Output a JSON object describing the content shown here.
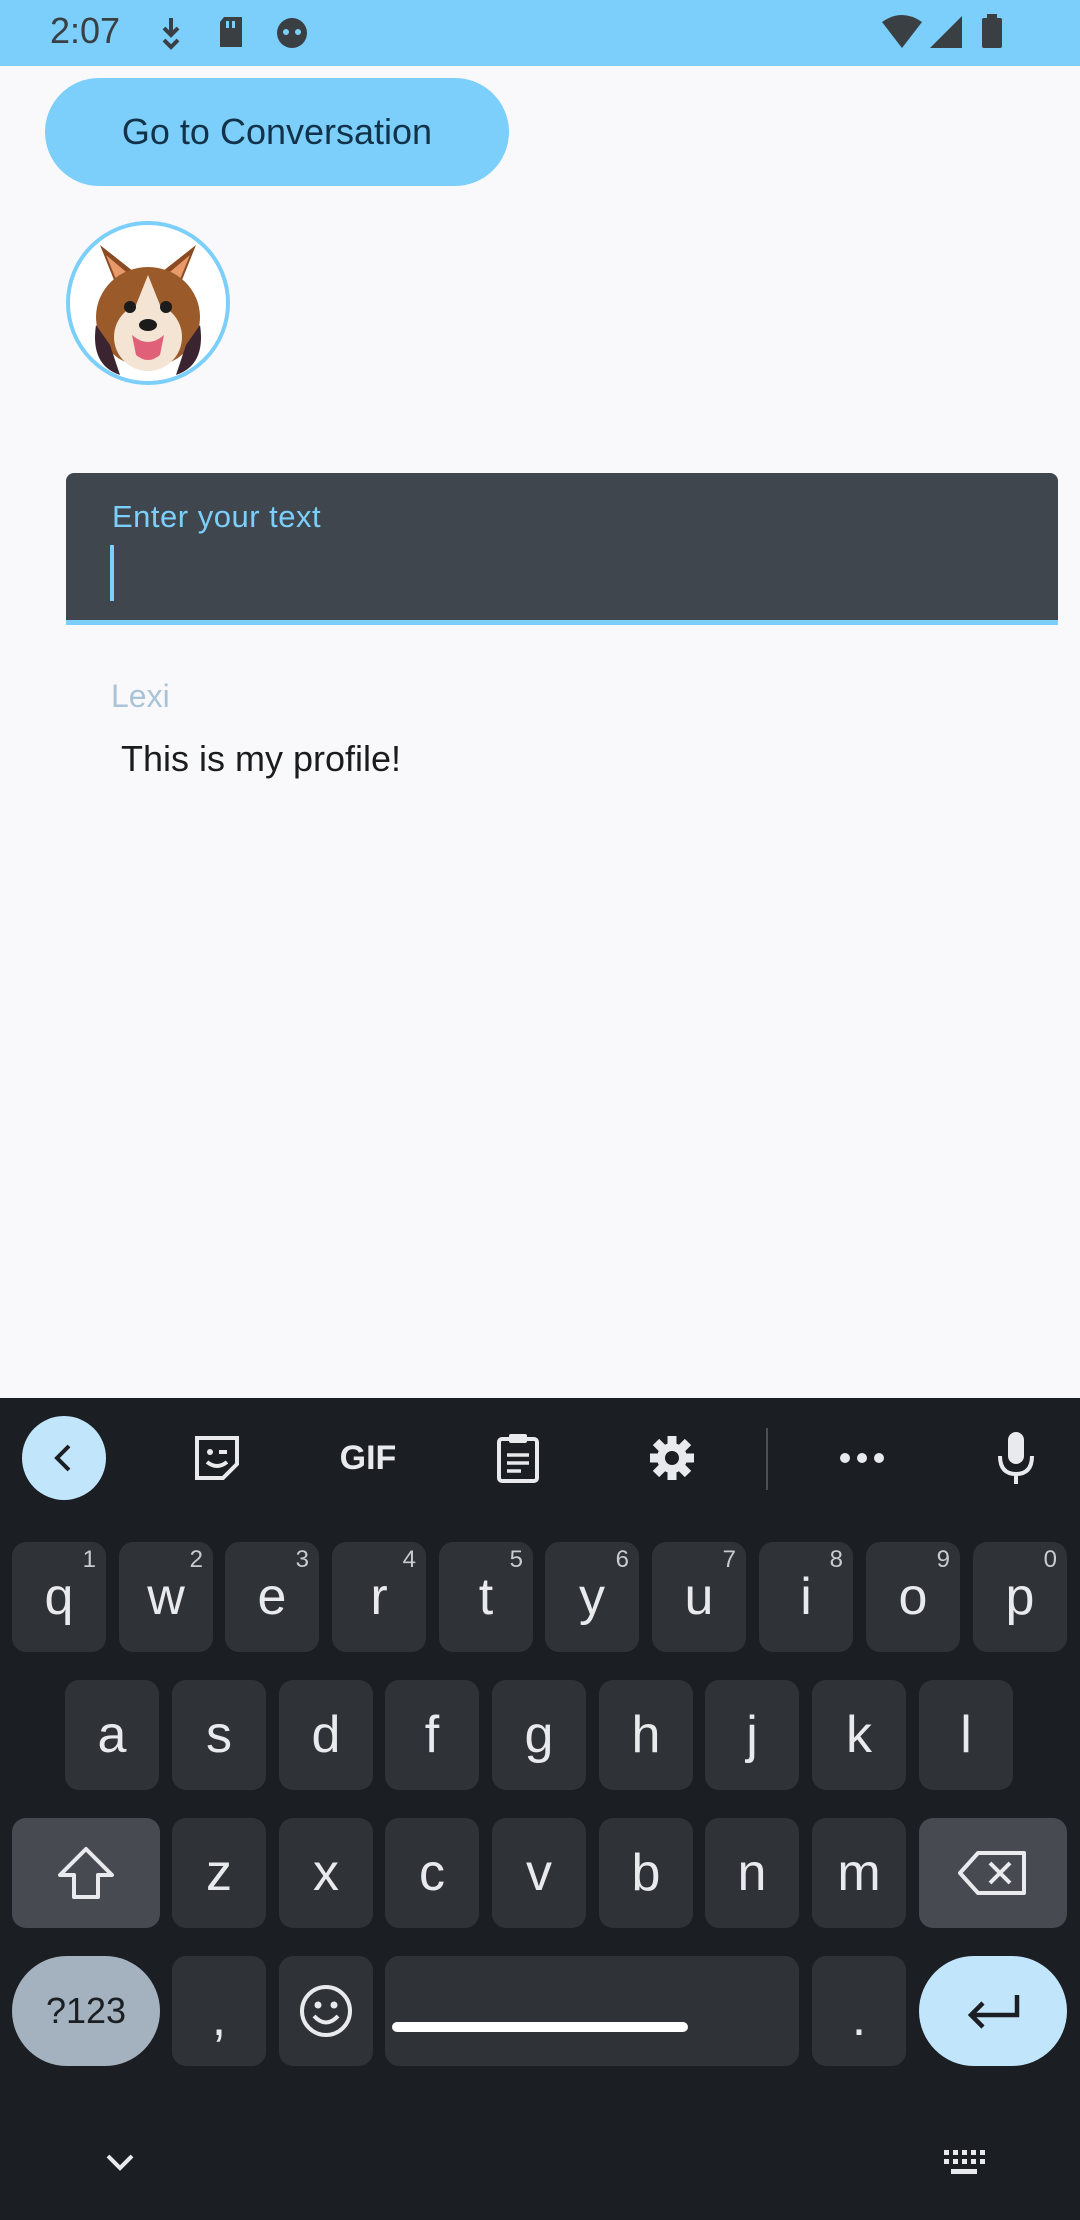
{
  "status_bar": {
    "time": "2:07"
  },
  "app": {
    "goto_button_label": "Go to Conversation",
    "text_field": {
      "label": "Enter your text",
      "value": ""
    },
    "author": "Lexi",
    "profile_text": "This is my profile!"
  },
  "keyboard": {
    "toolbar": [
      "back-icon",
      "sticker-icon",
      "gif-icon",
      "clipboard-icon",
      "settings-icon",
      "more-icon",
      "mic-icon"
    ],
    "gif_label": "GIF",
    "row1": [
      {
        "k": "q",
        "h": "1"
      },
      {
        "k": "w",
        "h": "2"
      },
      {
        "k": "e",
        "h": "3"
      },
      {
        "k": "r",
        "h": "4"
      },
      {
        "k": "t",
        "h": "5"
      },
      {
        "k": "y",
        "h": "6"
      },
      {
        "k": "u",
        "h": "7"
      },
      {
        "k": "i",
        "h": "8"
      },
      {
        "k": "o",
        "h": "9"
      },
      {
        "k": "p",
        "h": "0"
      }
    ],
    "row2": [
      "a",
      "s",
      "d",
      "f",
      "g",
      "h",
      "j",
      "k",
      "l"
    ],
    "row3": [
      "z",
      "x",
      "c",
      "v",
      "b",
      "n",
      "m"
    ],
    "sym_label": "?123",
    "comma": ",",
    "period": "."
  },
  "colors": {
    "accent": "#7ccffa",
    "keyboard_bg": "#1b1e22",
    "key_bg": "#2f3236"
  }
}
